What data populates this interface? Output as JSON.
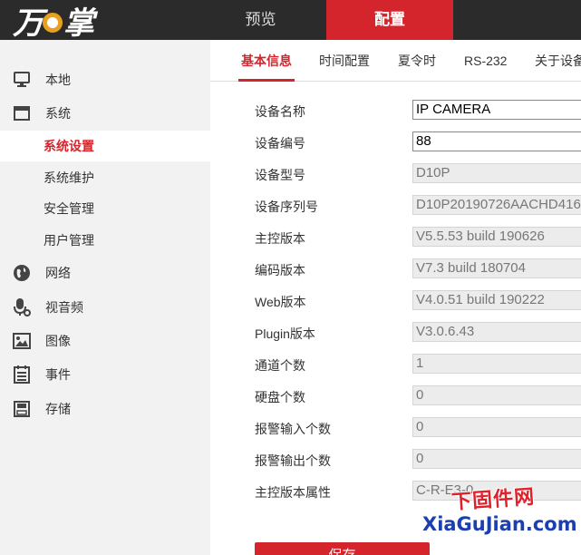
{
  "header": {
    "logo_text": "万店掌",
    "nav": [
      {
        "label": "预览",
        "active": false
      },
      {
        "label": "配置",
        "active": true
      }
    ],
    "accent_color": "#d5252c"
  },
  "sidebar": {
    "items": [
      {
        "label": "本地",
        "icon": "monitor-icon"
      },
      {
        "label": "系统",
        "icon": "system-icon"
      },
      {
        "label": "网络",
        "icon": "globe-icon"
      },
      {
        "label": "视音频",
        "icon": "microphone-icon"
      },
      {
        "label": "图像",
        "icon": "image-icon"
      },
      {
        "label": "事件",
        "icon": "event-list-icon"
      },
      {
        "label": "存储",
        "icon": "storage-disk-icon"
      }
    ],
    "sub_items": [
      {
        "label": "系统设置",
        "active": true
      },
      {
        "label": "系统维护",
        "active": false
      },
      {
        "label": "安全管理",
        "active": false
      },
      {
        "label": "用户管理",
        "active": false
      }
    ]
  },
  "tabs": [
    {
      "label": "基本信息",
      "active": true
    },
    {
      "label": "时间配置",
      "active": false
    },
    {
      "label": "夏令时",
      "active": false
    },
    {
      "label": "RS-232",
      "active": false
    },
    {
      "label": "关于设备",
      "active": false
    }
  ],
  "form": {
    "rows": [
      {
        "label": "设备名称",
        "value": "IP CAMERA",
        "editable": true
      },
      {
        "label": "设备编号",
        "value": "88",
        "editable": true
      },
      {
        "label": "设备型号",
        "value": "D10P",
        "editable": false
      },
      {
        "label": "设备序列号",
        "value": "D10P20190726AACHD416",
        "editable": false
      },
      {
        "label": "主控版本",
        "value": "V5.5.53 build 190626",
        "editable": false
      },
      {
        "label": "编码版本",
        "value": "V7.3 build 180704",
        "editable": false
      },
      {
        "label": "Web版本",
        "value": "V4.0.51 build 190222",
        "editable": false
      },
      {
        "label": "Plugin版本",
        "value": "V3.0.6.43",
        "editable": false
      },
      {
        "label": "通道个数",
        "value": "1",
        "editable": false
      },
      {
        "label": "硬盘个数",
        "value": "0",
        "editable": false
      },
      {
        "label": "报警输入个数",
        "value": "0",
        "editable": false
      },
      {
        "label": "报警输出个数",
        "value": "0",
        "editable": false
      },
      {
        "label": "主控版本属性",
        "value": "C-R-E3-0",
        "editable": false
      }
    ],
    "save_label": "保存"
  },
  "watermark": {
    "line1": "下固件网",
    "line2": "XiaGuJian.com"
  }
}
